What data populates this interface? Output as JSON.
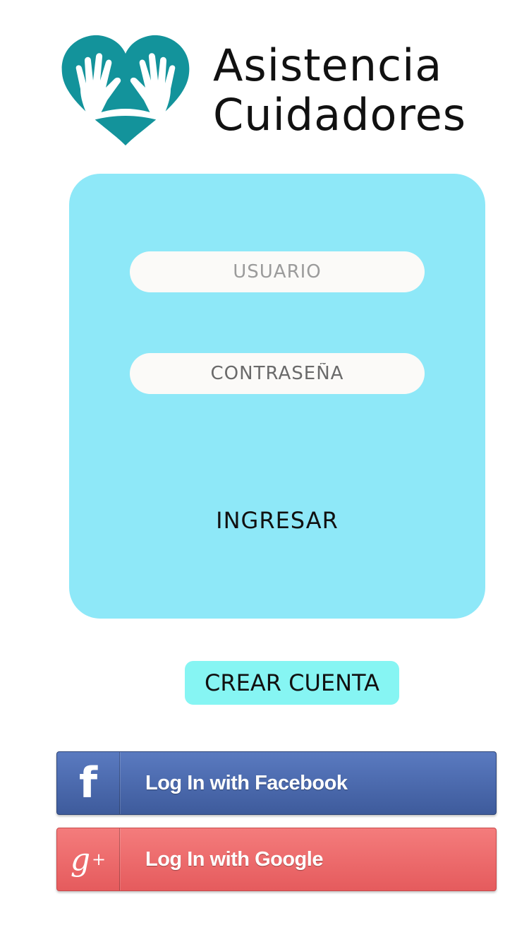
{
  "brand": {
    "line1": "Asistencia",
    "line2": "Cuidadores",
    "color": "#13939b"
  },
  "login_card": {
    "background": "#8ee8f8",
    "username_placeholder": "USUARIO",
    "password_placeholder": "CONTRASEÑA",
    "submit_label": "INGRESAR"
  },
  "create_account": {
    "label": "CREAR CUENTA",
    "background": "#86f5f3"
  },
  "social_login": {
    "facebook": {
      "icon": "facebook-f-icon",
      "icon_glyph": "f",
      "label": "Log In with Facebook",
      "color": "#4a66ac"
    },
    "google": {
      "icon": "google-plus-icon",
      "icon_glyph": "g",
      "icon_sup": "+",
      "label": "Log In with Google",
      "color": "#ee6b6d"
    }
  }
}
